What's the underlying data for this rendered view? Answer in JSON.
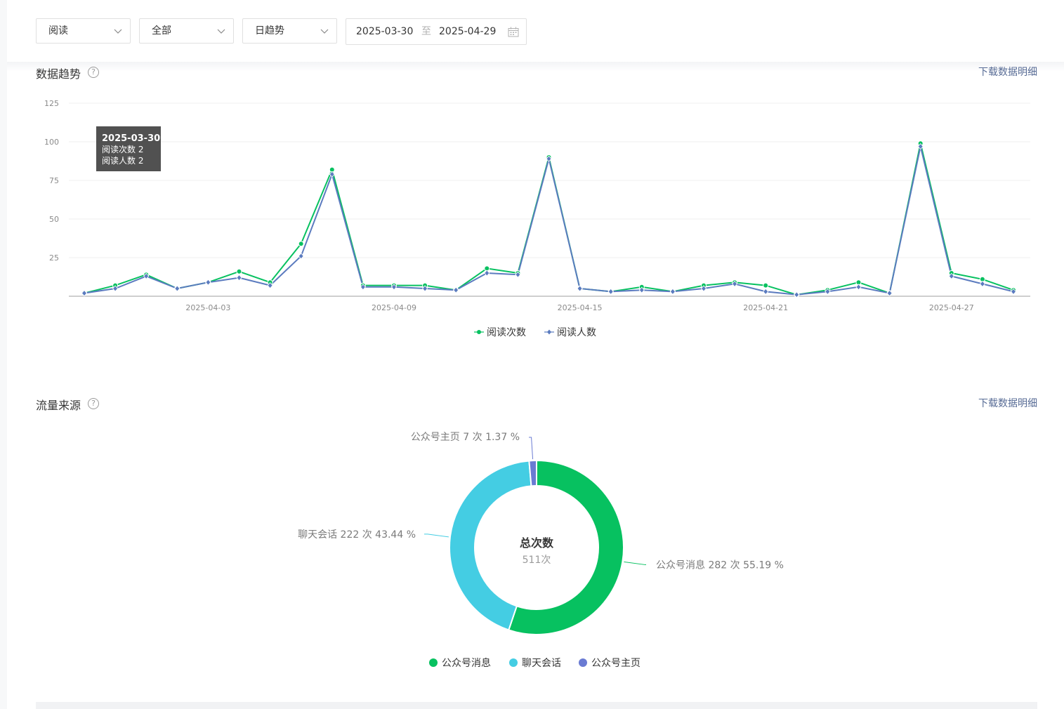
{
  "filters": {
    "metric": "阅读",
    "source": "全部",
    "granularity": "日趋势",
    "date_start": "2025-03-30",
    "date_sep": "至",
    "date_end": "2025-04-29"
  },
  "trend": {
    "title": "数据趋势",
    "download_label": "下载数据明细",
    "tooltip": {
      "date": "2025-03-30",
      "line1": "阅读次数 2",
      "line2": "阅读人数 2"
    }
  },
  "traffic": {
    "title": "流量来源",
    "download_label": "下载数据明细",
    "center_title": "总次数",
    "center_value": "511次",
    "labels": [
      "公众号消息 282 次 55.19 %",
      "聊天会话 222 次 43.44 %",
      "公众号主页 7 次 1.37 %"
    ]
  },
  "colors": {
    "green": "#07c160",
    "blue": "#5b7bbf",
    "cyan": "#44cde3",
    "purple": "#6a7bd3"
  },
  "chart_data": [
    {
      "type": "line",
      "x": [
        "2025-03-30",
        "2025-03-31",
        "2025-04-01",
        "2025-04-02",
        "2025-04-03",
        "2025-04-04",
        "2025-04-05",
        "2025-04-06",
        "2025-04-07",
        "2025-04-08",
        "2025-04-09",
        "2025-04-10",
        "2025-04-11",
        "2025-04-12",
        "2025-04-13",
        "2025-04-14",
        "2025-04-15",
        "2025-04-16",
        "2025-04-17",
        "2025-04-18",
        "2025-04-19",
        "2025-04-20",
        "2025-04-21",
        "2025-04-22",
        "2025-04-23",
        "2025-04-24",
        "2025-04-25",
        "2025-04-26",
        "2025-04-27",
        "2025-04-28",
        "2025-04-29"
      ],
      "x_ticks": [
        "2025-04-03",
        "2025-04-09",
        "2025-04-15",
        "2025-04-21",
        "2025-04-27"
      ],
      "series": [
        {
          "name": "阅读次数",
          "values": [
            2,
            7,
            14,
            5,
            9,
            16,
            9,
            34,
            82,
            7,
            7,
            7,
            4,
            18,
            15,
            90,
            5,
            3,
            6,
            3,
            7,
            9,
            7,
            1,
            4,
            9,
            2,
            99,
            15,
            11,
            4
          ]
        },
        {
          "name": "阅读人数",
          "values": [
            2,
            5,
            13,
            5,
            9,
            12,
            7,
            26,
            79,
            6,
            6,
            5,
            4,
            15,
            14,
            89,
            5,
            3,
            4,
            3,
            5,
            8,
            3,
            1,
            3,
            6,
            2,
            97,
            13,
            8,
            3
          ]
        }
      ],
      "ylim": [
        0,
        125
      ],
      "y_ticks": [
        25,
        50,
        75,
        100,
        125
      ],
      "grid": true,
      "legend": "bottom"
    },
    {
      "type": "pie",
      "categories": [
        "公众号消息",
        "聊天会话",
        "公众号主页"
      ],
      "values": [
        282,
        222,
        7
      ],
      "percent": [
        55.19,
        43.44,
        1.37
      ],
      "total": 511,
      "legend": "bottom"
    }
  ]
}
